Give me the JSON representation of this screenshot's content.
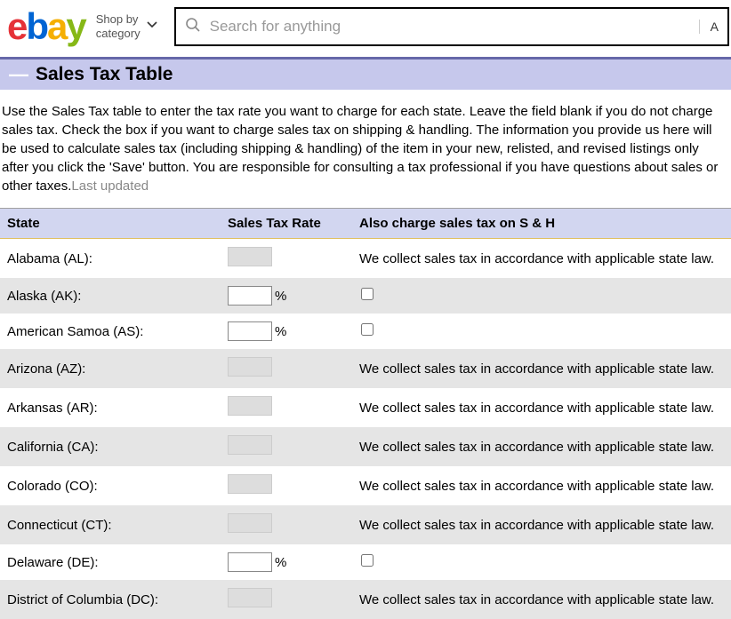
{
  "header": {
    "logo_letters": [
      "e",
      "b",
      "a",
      "y"
    ],
    "shop_category_line1": "Shop by",
    "shop_category_line2": "category",
    "search_placeholder": "Search for anything",
    "search_side_char": "A"
  },
  "title": "Sales Tax Table",
  "description": "Use the Sales Tax table to enter the tax rate you want to charge for each state. Leave the field blank if you do not charge sales tax. Check the box if you want to charge sales tax on shipping & handling. The information you provide us here will be used to calculate sales tax (including shipping & handling) of the item in your new, relisted, and revised listings only after you click the 'Save' button. You are responsible for consulting a tax professional if you have questions about sales or other taxes.",
  "last_updated_label": "Last updated",
  "columns": {
    "state": "State",
    "rate": "Sales Tax Rate",
    "sh": "Also charge sales tax on S & H"
  },
  "collect_msg": "We collect sales tax in accordance with applicable state law.",
  "rows": [
    {
      "state": "Alabama (AL):",
      "editable": false
    },
    {
      "state": "Alaska (AK):",
      "editable": true,
      "rate": ""
    },
    {
      "state": "American Samoa (AS):",
      "editable": true,
      "rate": ""
    },
    {
      "state": "Arizona (AZ):",
      "editable": false
    },
    {
      "state": "Arkansas (AR):",
      "editable": false
    },
    {
      "state": "California (CA):",
      "editable": false
    },
    {
      "state": "Colorado (CO):",
      "editable": false
    },
    {
      "state": "Connecticut (CT):",
      "editable": false
    },
    {
      "state": "Delaware (DE):",
      "editable": true,
      "rate": ""
    },
    {
      "state": "District of Columbia (DC):",
      "editable": false
    }
  ]
}
